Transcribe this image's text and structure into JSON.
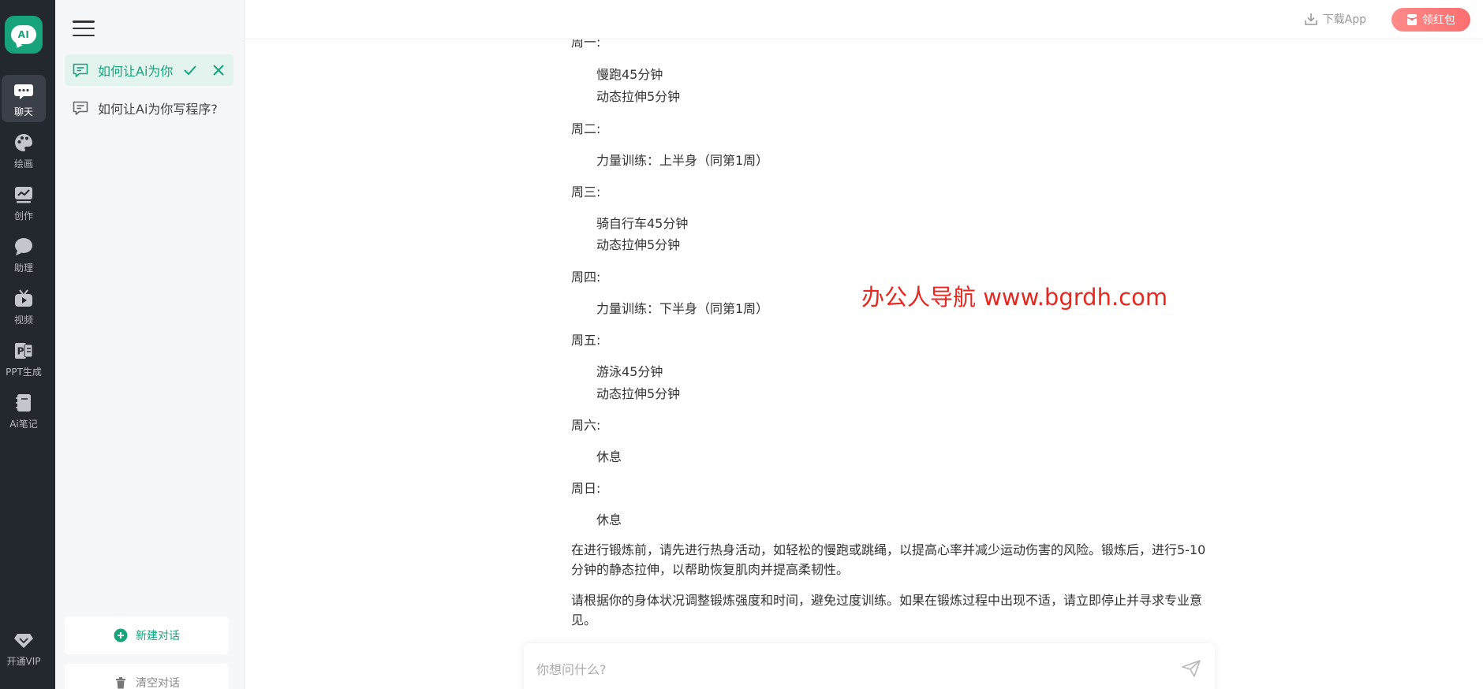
{
  "rail": {
    "logo_text": "AI",
    "items": [
      {
        "label": "聊天",
        "icon": "chat-icon",
        "active": true
      },
      {
        "label": "绘画",
        "icon": "palette-icon"
      },
      {
        "label": "创作",
        "icon": "chart-icon"
      },
      {
        "label": "助理",
        "icon": "bubble-icon"
      },
      {
        "label": "视频",
        "icon": "tv-icon"
      },
      {
        "label": "PPT生成",
        "icon": "ppt-icon"
      },
      {
        "label": "Ai笔记",
        "icon": "notebook-icon"
      }
    ],
    "vip_label": "开通VIP"
  },
  "sidebar": {
    "conversations": [
      {
        "title": "如何让Ai为你",
        "editing": true
      },
      {
        "title": "如何让Ai为你写程序?"
      }
    ],
    "new_chat_label": "新建对话",
    "clear_label": "清空对话"
  },
  "topbar": {
    "download_label": "下载App",
    "red_packet_label": "领红包"
  },
  "message": {
    "days": [
      {
        "day": "周一:",
        "items": [
          "慢跑45分钟",
          "动态拉伸5分钟"
        ]
      },
      {
        "day": "周二:",
        "items": [
          "力量训练：上半身（同第1周）"
        ]
      },
      {
        "day": "周三:",
        "items": [
          "骑自行车45分钟",
          "动态拉伸5分钟"
        ]
      },
      {
        "day": "周四:",
        "items": [
          "力量训练：下半身（同第1周）"
        ]
      },
      {
        "day": "周五:",
        "items": [
          "游泳45分钟",
          "动态拉伸5分钟"
        ]
      },
      {
        "day": "周六:",
        "items": [
          "休息"
        ]
      },
      {
        "day": "周日:",
        "items": [
          "休息"
        ]
      }
    ],
    "paragraphs": [
      "在进行锻炼前，请先进行热身活动，如轻松的慢跑或跳绳，以提高心率并减少运动伤害的风险。锻炼后，进行5-10分钟的静态拉伸，以帮助恢复肌肉并提高柔韧性。",
      "请根据你的身体状况调整锻炼强度和时间，避免过度训练。如果在锻炼过程中出现不适，请立即停止并寻求专业意见。"
    ]
  },
  "watermark": "办公人导航 www.bgrdh.com",
  "input": {
    "value": "",
    "placeholder": "你想问什么?"
  },
  "colors": {
    "accent": "#17a37c",
    "rail_bg": "#23272e",
    "red": "#fb6e6e"
  }
}
